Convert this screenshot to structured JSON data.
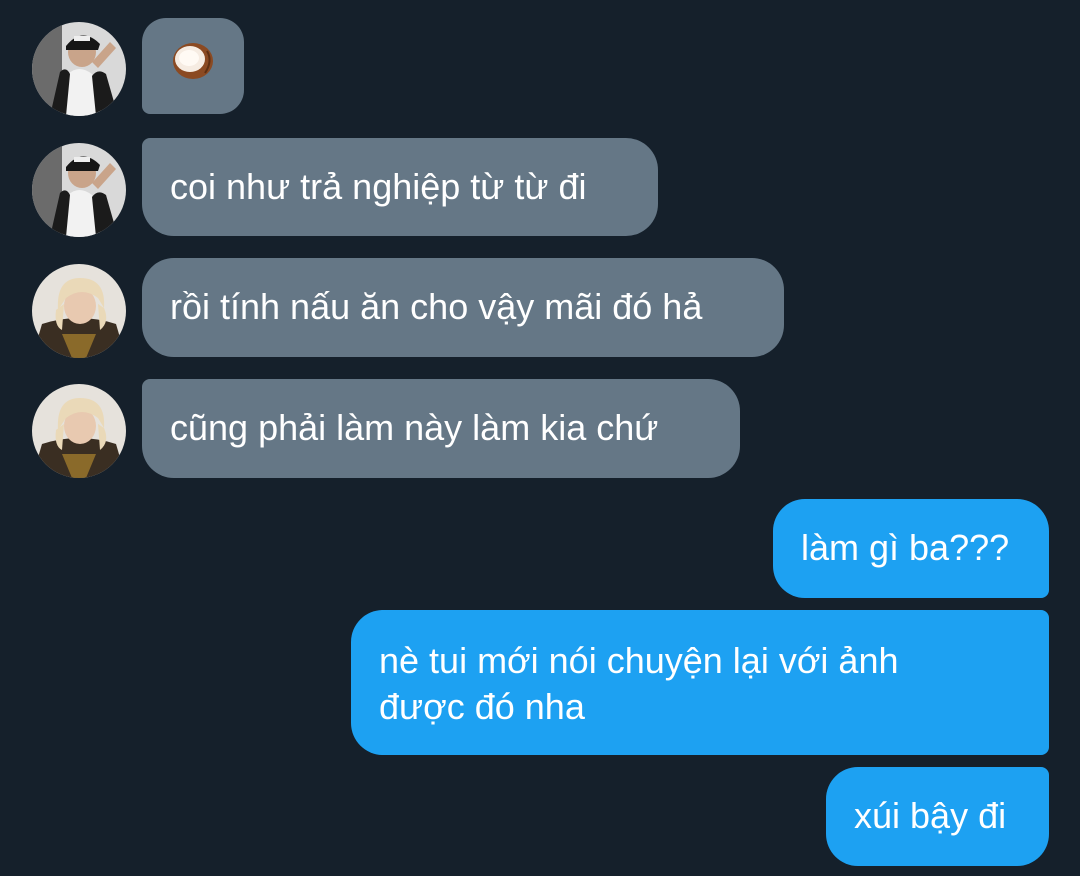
{
  "colors": {
    "background": "#15202b",
    "incoming_bubble": "#657786",
    "outgoing_bubble": "#1da1f2",
    "text": "#ffffff"
  },
  "messages": [
    {
      "direction": "incoming",
      "sender": "user-1",
      "content": "coconut-emoji"
    },
    {
      "direction": "incoming",
      "sender": "user-1",
      "text": "coi như trả nghiệp từ từ đi"
    },
    {
      "direction": "incoming",
      "sender": "user-2",
      "text": "rồi tính nấu ăn cho vậy mãi đó hả"
    },
    {
      "direction": "incoming",
      "sender": "user-2",
      "text": "cũng phải làm này làm kia chứ"
    },
    {
      "direction": "outgoing",
      "text": "làm gì ba???"
    },
    {
      "direction": "outgoing",
      "lines": [
        "nè tui mới nói chuyện lại với ảnh",
        "được đó nha"
      ]
    },
    {
      "direction": "outgoing",
      "text": "xúi bậy đi"
    }
  ]
}
